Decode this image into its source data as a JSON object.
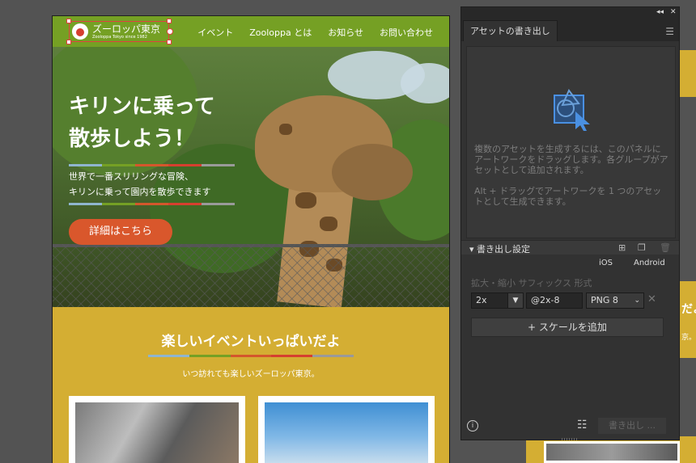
{
  "site": {
    "logo_title": "ズーロッパ東京",
    "logo_sub": "Zooloppa Tokyo since 1982",
    "nav": [
      "イベント",
      "Zooloppa とは",
      "お知らせ",
      "お問い合わせ"
    ],
    "hero_title_line1": "キリンに乗って",
    "hero_title_line2": "散歩しよう！",
    "hero_desc_line1": "世界で一番スリリングな冒険、",
    "hero_desc_line2": "キリンに乗って園内を散歩できます",
    "cta_label": "詳細はこちら",
    "events_title": "楽しいイベントいっぱいだよ",
    "events_sub": "いつ訪れても楽しいズーロッパ東京。",
    "stripe_colors": [
      "#8fb5cf",
      "#75a024",
      "#d4572c",
      "#d63f2f",
      "#9a9a9a"
    ]
  },
  "bg_fragment": {
    "snippet1": "だよ",
    "snippet2": "京。"
  },
  "panel": {
    "tab_label": "アセットの書き出し",
    "drop_text_1": "複数のアセットを生成するには、このパネルにアートワークをドラッグします。各グループがアセットとして追加されます。",
    "drop_text_2": "Alt + ドラッグでアートワークを 1 つのアセットとして生成できます。",
    "section_title": "書き出し設定",
    "col_ios": "iOS",
    "col_android": "Android",
    "field_labels": "拡大・縮小  サフィックス  形式",
    "scale_value": "2x",
    "suffix_value": "@2x-8",
    "format_value": "PNG 8",
    "add_scale_label": "スケールを追加",
    "export_label": "書き出し ..."
  }
}
